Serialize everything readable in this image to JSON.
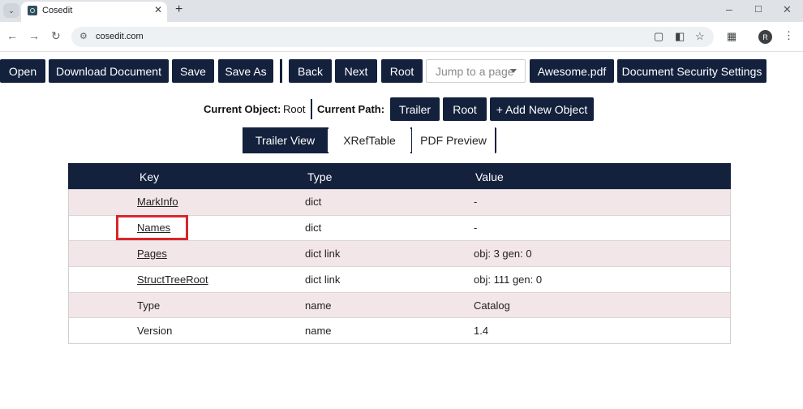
{
  "browser": {
    "tab_title": "Cosedit",
    "url": "cosedit.com",
    "profile_initial": "R",
    "icons": [
      "tab-list-icon",
      "favicon-icon",
      "close-icon",
      "plus-icon",
      "minimize-icon",
      "maximize-icon",
      "close-window-icon",
      "back-icon",
      "forward-icon",
      "reload-icon",
      "site-info-icon",
      "install-app-icon",
      "document-icon",
      "bookmark-star-icon",
      "extensions-icon",
      "kebab-menu-icon"
    ]
  },
  "toolbar": {
    "open": "Open",
    "download": "Download Document",
    "save": "Save",
    "save_as": "Save As",
    "back": "Back",
    "next": "Next",
    "root": "Root",
    "jump_placeholder": "Jump to a page",
    "file": "Awesome.pdf",
    "security": "Document Security Settings"
  },
  "object": {
    "current_object_label": "Current Object:",
    "current_object_value": "Root",
    "current_path_label": "Current Path:",
    "path": [
      "Trailer",
      "Root"
    ],
    "add_new": "+ Add New Object"
  },
  "views": {
    "tabs": [
      "Trailer View",
      "XRefTable",
      "PDF Preview"
    ],
    "active": "Trailer View"
  },
  "table": {
    "headers": [
      "Key",
      "Type",
      "Value"
    ],
    "rows": [
      {
        "key": "MarkInfo",
        "type": "dict",
        "value": "-",
        "link": true
      },
      {
        "key": "Names",
        "type": "dict",
        "value": "-",
        "link": true
      },
      {
        "key": "Pages",
        "type": "dict link",
        "value": "obj: 3 gen: 0",
        "link": true
      },
      {
        "key": "StructTreeRoot",
        "type": "dict link",
        "value": "obj: 111 gen: 0",
        "link": true
      },
      {
        "key": "Type",
        "type": "name",
        "value": "Catalog",
        "link": false
      },
      {
        "key": "Version",
        "type": "name",
        "value": "1.4",
        "link": false
      }
    ]
  },
  "colors": {
    "navy": "#13213d",
    "row_tint": "#f3e6e9",
    "highlight": "#d9262b"
  }
}
